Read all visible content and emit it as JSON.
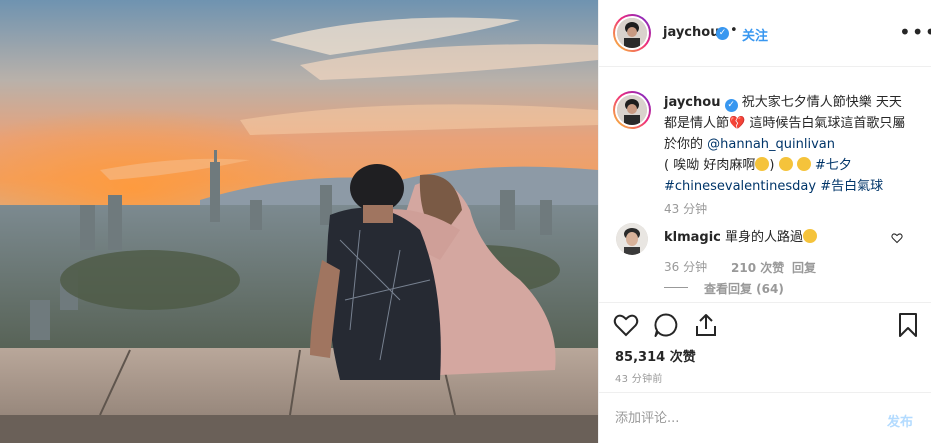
{
  "post": {
    "username": "jaychou",
    "verified_icon": "verified-badge-icon",
    "dot": "•",
    "follow_label": "关注",
    "more_icon": "more-options-icon",
    "more_label": "•••"
  },
  "caption": {
    "username": "jaychou",
    "text_1": "祝大家七夕情人節快樂 天天都是情人節",
    "heart": "💔",
    "text_2": " 這時候告白氣球這首歌只屬於你的 ",
    "mention": "@hannah_quinlivan",
    "text_3": " ( 唉呦 好肉麻啊",
    "text_4": ") ",
    "hashtag_1": "#七夕",
    "hashtag_2": "#chinesevalentinesday",
    "hashtag_3": "#告白氣球",
    "age": "43 分钟"
  },
  "comments": [
    {
      "username": "klmagic",
      "text": "單身的人路過",
      "age": "36 分钟",
      "likes": "210 次赞",
      "reply_label": "回复",
      "view_replies": "查看回复 (64)"
    }
  ],
  "actions": {
    "like_icon": "heart-icon",
    "comment_icon": "comment-icon",
    "share_icon": "share-icon",
    "save_icon": "bookmark-icon"
  },
  "likes_count": "85,314 次赞",
  "timestamp": "43 分钟前",
  "add_comment": {
    "placeholder": "添加评论...",
    "post_label": "发布"
  },
  "colors": {
    "link": "#003569",
    "accent": "#3897f0",
    "muted": "#999999",
    "post_disabled": "#b3dbff"
  }
}
